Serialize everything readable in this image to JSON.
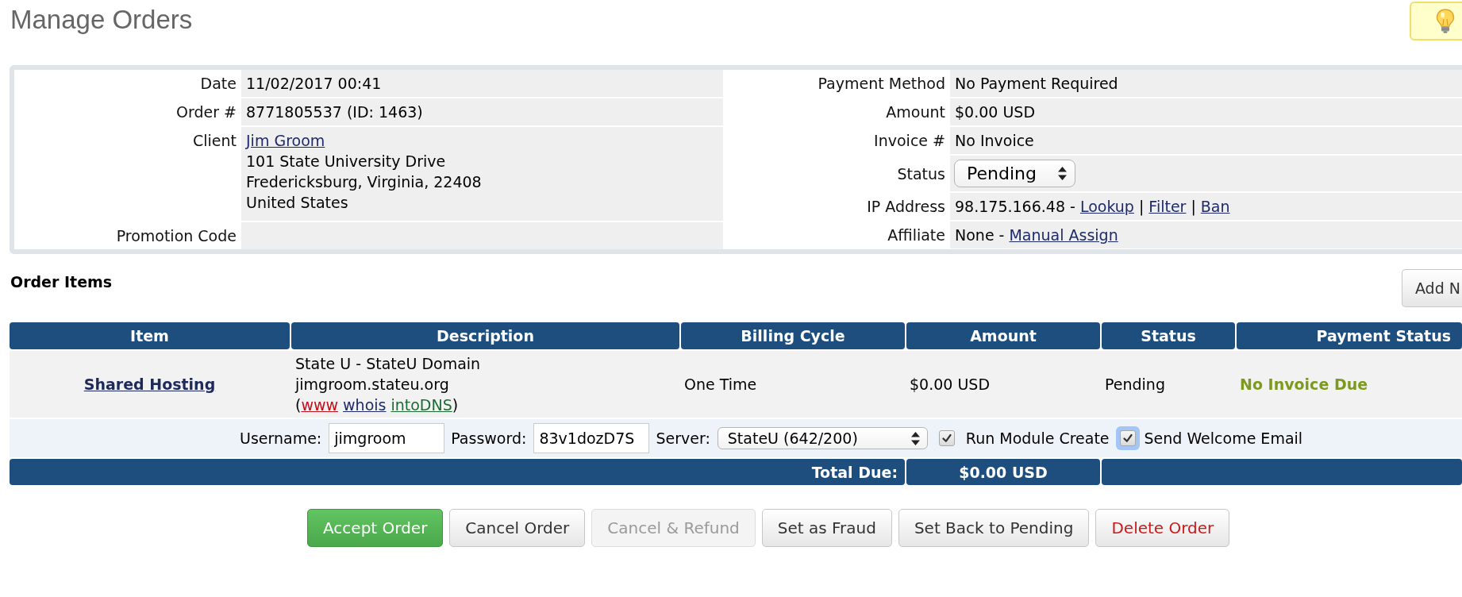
{
  "page": {
    "title": "Manage Orders"
  },
  "order_details": {
    "left": [
      {
        "label": "Date",
        "kind": "inline",
        "parts": [
          {
            "kind": "text",
            "text": "11/02/2017 00:41"
          }
        ]
      },
      {
        "label": "Order #",
        "kind": "inline",
        "parts": [
          {
            "kind": "text",
            "text": "8771805537 (ID: 1463)"
          }
        ]
      },
      {
        "label": "Client",
        "kind": "stacked",
        "parts": [
          {
            "kind": "link",
            "text": "Jim Groom"
          },
          {
            "kind": "text",
            "text": "101 State University Drive"
          },
          {
            "kind": "text",
            "text": "Fredericksburg, Virginia, 22408"
          },
          {
            "kind": "text",
            "text": "United States"
          }
        ]
      },
      {
        "label": "Promotion Code",
        "kind": "inline"
      }
    ],
    "right": [
      {
        "label": "Payment Method",
        "kind": "inline",
        "parts": [
          {
            "kind": "text",
            "text": "No Payment Required"
          }
        ]
      },
      {
        "label": "Amount",
        "kind": "inline",
        "parts": [
          {
            "kind": "text",
            "text": "$0.00 USD"
          }
        ]
      },
      {
        "label": "Invoice #",
        "kind": "inline",
        "parts": [
          {
            "kind": "text",
            "text": "No Invoice"
          }
        ]
      },
      {
        "label": "Status",
        "kind": "select",
        "value": "Pending"
      },
      {
        "label": "IP Address",
        "kind": "inline",
        "parts": [
          {
            "kind": "text",
            "text": "98.175.166.48 -"
          },
          {
            "kind": "link",
            "text": "Lookup"
          },
          {
            "kind": "separator",
            "text": "|"
          },
          {
            "kind": "link",
            "text": "Filter"
          },
          {
            "kind": "separator",
            "text": "|"
          },
          {
            "kind": "link",
            "text": "Ban"
          }
        ]
      },
      {
        "label": "Affiliate",
        "kind": "inline",
        "parts": [
          {
            "kind": "text",
            "text": "None -"
          },
          {
            "kind": "link",
            "text": "Manual Assign"
          }
        ]
      }
    ]
  },
  "order_items": {
    "title": "Order Items",
    "add_button": "Add N",
    "columns": [
      "Item",
      "Description",
      "Billing Cycle",
      "Amount",
      "Status",
      "Payment Status"
    ],
    "rows": [
      {
        "item": "Shared Hosting",
        "description": [
          "State U - StateU Domain",
          "jimgroom.stateu.org"
        ],
        "domain_links": {
          "open": "(",
          "links": [
            {
              "text": "www",
              "color": "#c0101a"
            },
            {
              "text": "whois",
              "color": "#1f2a6b"
            },
            {
              "text": "intoDNS",
              "color": "#1d6b34"
            }
          ],
          "close": ")"
        },
        "billing_cycle": "One Time",
        "amount": "$0.00 USD",
        "status": "Pending",
        "payment_status": "No Invoice Due"
      }
    ],
    "module_settings": {
      "fields": [
        {
          "label": "Username:",
          "kind": "input",
          "value": "jimgroom"
        },
        {
          "label": "Password:",
          "kind": "input",
          "value": "83v1dozD7S"
        },
        {
          "label": "Server:",
          "kind": "select",
          "value": "StateU (642/200)"
        }
      ],
      "options": [
        {
          "label": "Run Module Create",
          "checked": true,
          "focused": false
        },
        {
          "label": "Send Welcome Email",
          "checked": true,
          "focused": true
        }
      ]
    },
    "total": {
      "label": "Total Due:",
      "value": "$0.00 USD"
    }
  },
  "actions": [
    {
      "label": "Accept Order",
      "kind": "primary",
      "disabled": false
    },
    {
      "label": "Cancel Order",
      "kind": "default",
      "disabled": false
    },
    {
      "label": "Cancel & Refund",
      "kind": "default",
      "disabled": true
    },
    {
      "label": "Set as Fraud",
      "kind": "default",
      "disabled": false
    },
    {
      "label": "Set Back to Pending",
      "kind": "default",
      "disabled": false
    },
    {
      "label": "Delete Order",
      "kind": "danger",
      "disabled": false
    }
  ]
}
